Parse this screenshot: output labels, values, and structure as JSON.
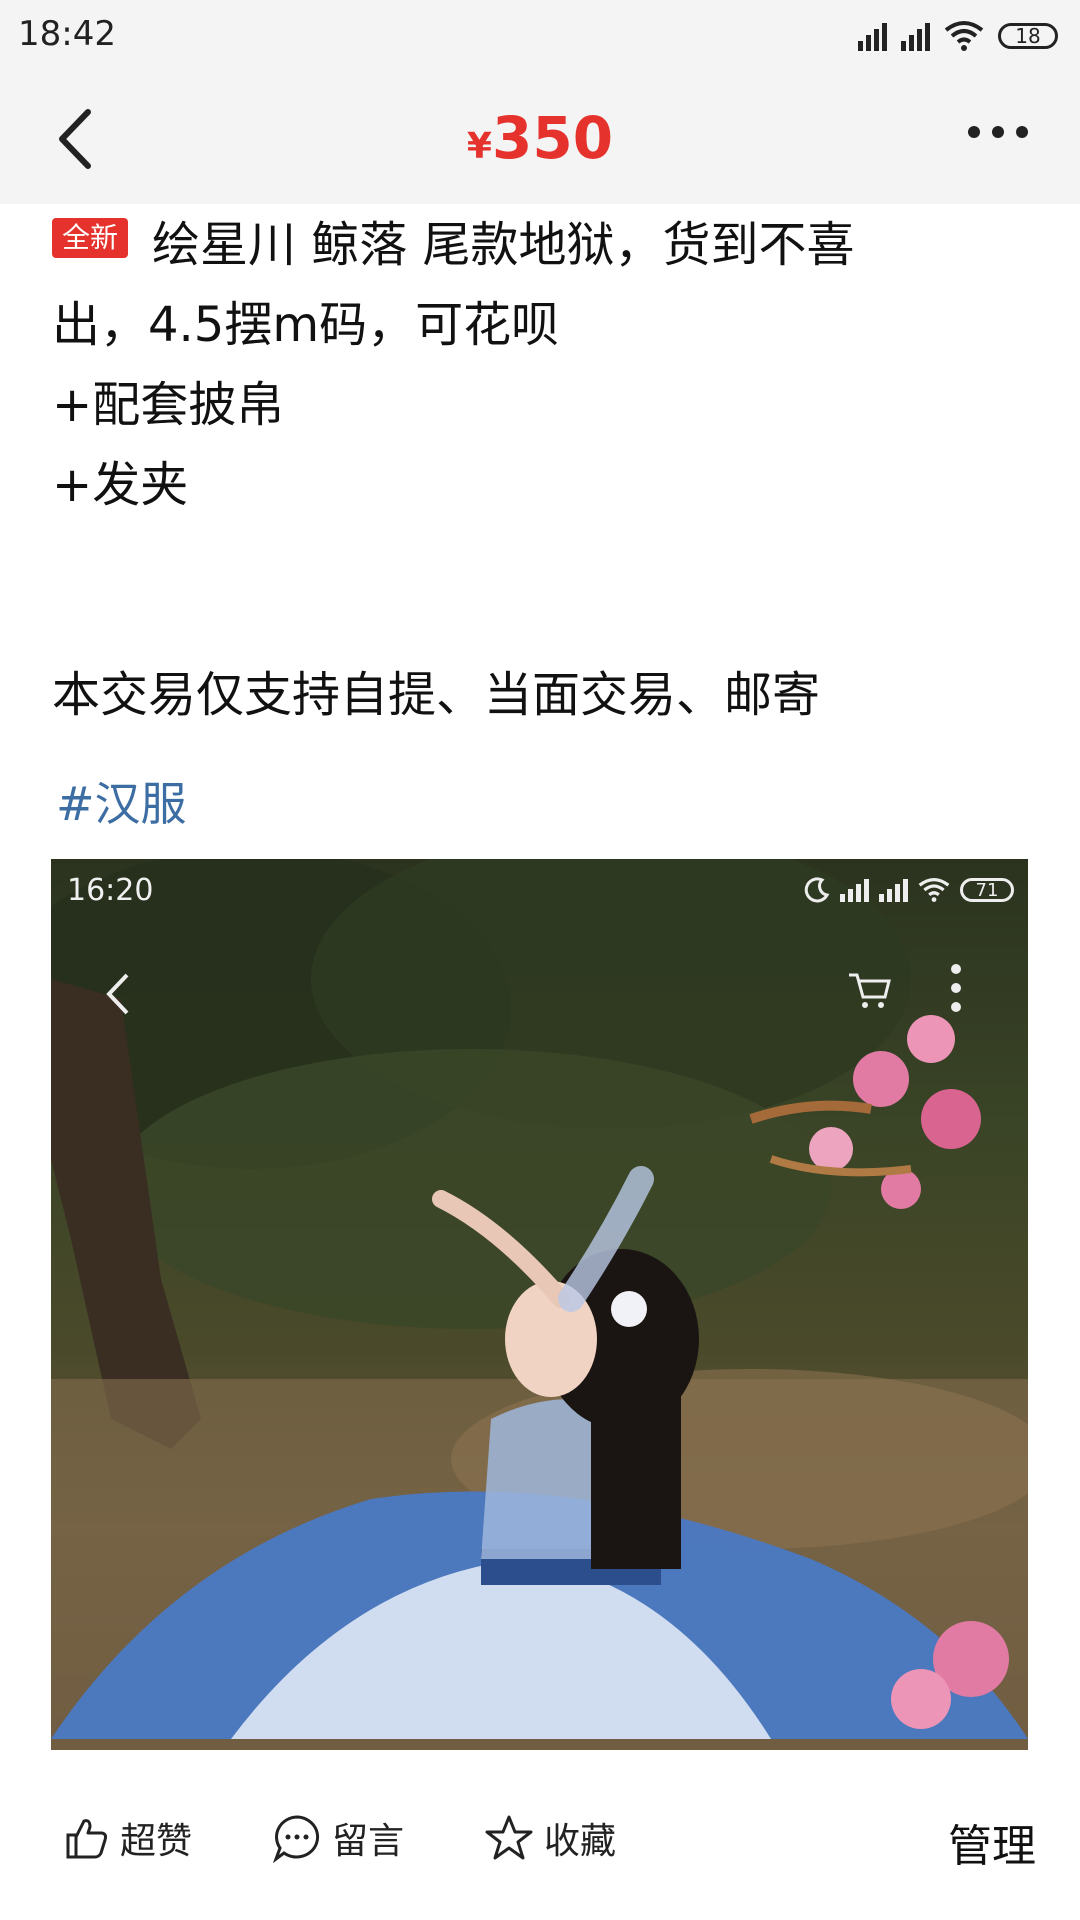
{
  "status_bar": {
    "time": "18:42",
    "battery": "18"
  },
  "header": {
    "currency": "¥",
    "price": "350"
  },
  "listing": {
    "badge": "全新",
    "lines": [
      "绘星川  鲸落 尾款地狱，货到不喜",
      "出，4.5摆m码，可花呗",
      "+配套披帛",
      "+发夹"
    ],
    "notice": "本交易仅支持自提、当面交易、邮寄",
    "tag": "#汉服"
  },
  "photo": {
    "inner_time": "16:20",
    "inner_battery": "71"
  },
  "bottom_bar": {
    "like": "超赞",
    "comment": "留言",
    "favorite": "收藏",
    "manage": "管理"
  }
}
